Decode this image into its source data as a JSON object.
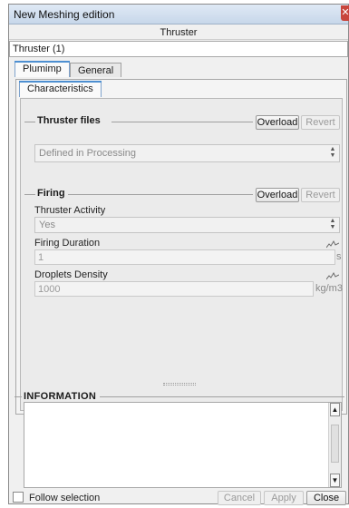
{
  "window": {
    "title": "New Meshing edition",
    "close_glyph": "✕"
  },
  "header": {
    "title": "Thruster"
  },
  "object": {
    "value": "Thruster (1)"
  },
  "tabs": [
    {
      "label": "Plumimp"
    },
    {
      "label": "General"
    }
  ],
  "subtabs": [
    {
      "label": "Characteristics"
    }
  ],
  "thruster_files": {
    "title": "Thruster files",
    "overload_label": "Overload",
    "revert_label": "Revert",
    "combo_value": "Defined in Processing"
  },
  "firing": {
    "title": "Firing",
    "overload_label": "Overload",
    "revert_label": "Revert",
    "activity_label": "Thruster Activity",
    "activity_value": "Yes",
    "duration_label": "Firing Duration",
    "duration_value": "1",
    "duration_unit": "s",
    "density_label": "Droplets Density",
    "density_value": "1000",
    "density_unit": "kg/m3"
  },
  "information": {
    "title": "INFORMATION"
  },
  "footer": {
    "follow_label": "Follow selection",
    "cancel_label": "Cancel",
    "apply_label": "Apply",
    "close_label": "Close"
  },
  "icons": {
    "spin": "spin-arrows-icon",
    "curve": "curve-icon"
  }
}
